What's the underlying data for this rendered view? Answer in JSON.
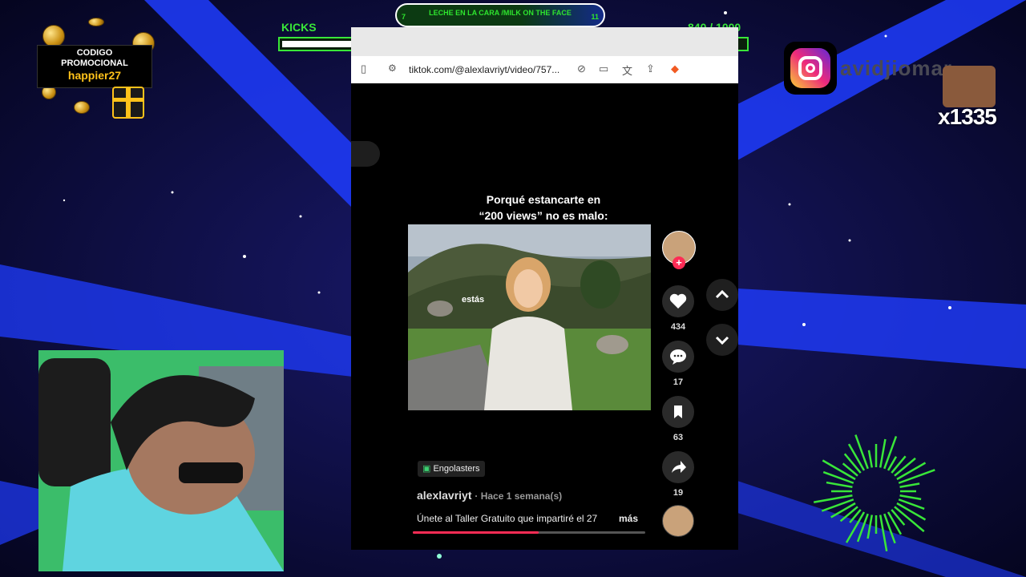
{
  "promo": {
    "line1": "CODIGO",
    "line2": "PROMOCIONAL",
    "code": "happier27"
  },
  "kicks": {
    "label": "KICKS",
    "current": "840",
    "separator": " / ",
    "goal": "1000",
    "progress": 0.84
  },
  "goal_pill": {
    "title": "LECHE EN LA CARA /MILK ON THE FACE",
    "left_count": "7",
    "right_count": "11"
  },
  "browser": {
    "url": "tiktok.com/@alexlavriyt/video/757..."
  },
  "video": {
    "caption_line1": "Porqué estancarte en",
    "caption_line2": "“200 views” no es malo:",
    "overlay_word": "estás",
    "progress": 0.54
  },
  "actions": {
    "likes": "434",
    "comments": "17",
    "saves": "63",
    "shares": "19"
  },
  "post": {
    "tag": "Engolasters",
    "author": "alexlavriyt",
    "time": "· Hace 1 semana(s)",
    "description": "Únete al Taller Gratuito que impartiré el 27",
    "more": "más"
  },
  "overlay_social": {
    "instagram_handle": "avidjiomar",
    "badge_number": "x1335"
  },
  "colors": {
    "accent_green": "#39e639",
    "tiktok_red": "#fe2c55",
    "promo_gold": "#ffc21a"
  }
}
